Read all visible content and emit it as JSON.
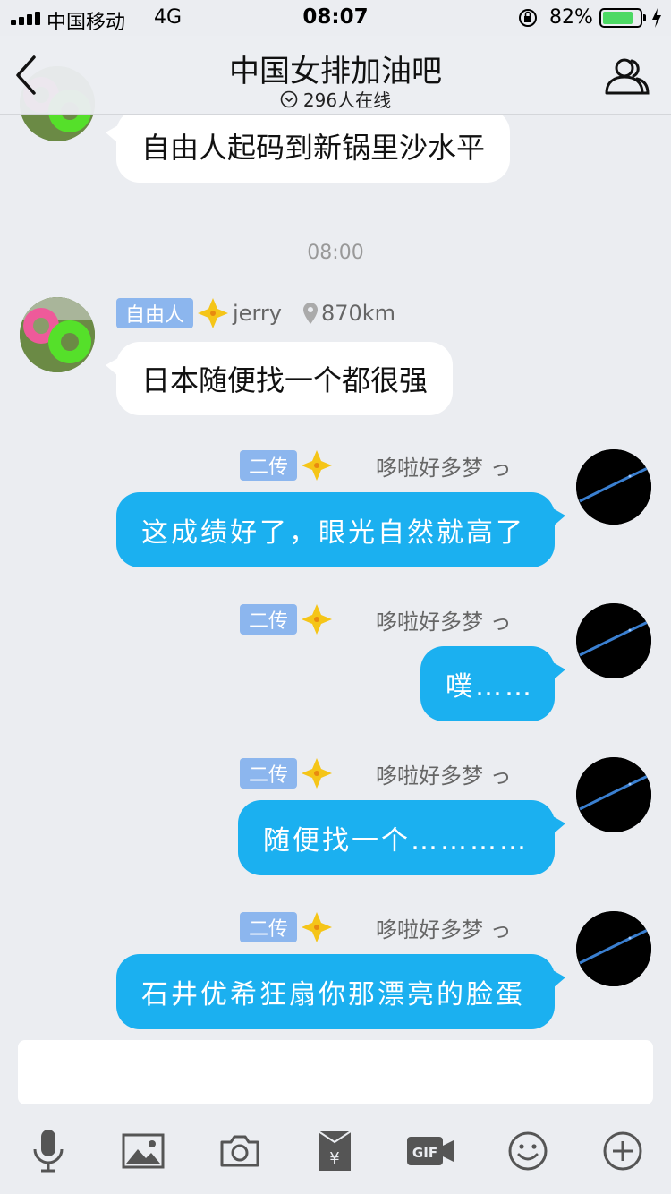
{
  "status_bar": {
    "carrier": "中国移动",
    "network": "4G",
    "time": "08:07",
    "battery_percent": "82%",
    "battery_level": 0.82
  },
  "header": {
    "title": "中国女排加油吧",
    "online": "296人在线"
  },
  "messages": {
    "m0": {
      "text": "自由人起码到新锅里沙水平"
    },
    "timestamp": "08:00",
    "m1": {
      "tag": "自由人",
      "name": "jerry",
      "distance": "870km",
      "text": "日本随便找一个都很强"
    },
    "m2": {
      "tag": "二传",
      "name": "哆啦好多梦 っ",
      "text": "这成绩好了，眼光自然就高了"
    },
    "m3": {
      "tag": "二传",
      "name": "哆啦好多梦 っ",
      "text": "噗……"
    },
    "m4": {
      "tag": "二传",
      "name": "哆啦好多梦 っ",
      "text": "随便找一个…………"
    },
    "m5": {
      "tag": "二传",
      "name": "哆啦好多梦 っ",
      "text": "石井优希狂扇你那漂亮的脸蛋"
    }
  },
  "input": {
    "placeholder": ""
  },
  "toolbar_icons": [
    "microphone-icon",
    "image-icon",
    "camera-icon",
    "red-packet-icon",
    "gif-icon",
    "emoji-icon",
    "plus-icon"
  ],
  "colors": {
    "bubble_blue": "#1bb0f0",
    "tag_blue": "#8cb6ee",
    "star_gold": "#f5c518",
    "background": "#ebedf1"
  }
}
